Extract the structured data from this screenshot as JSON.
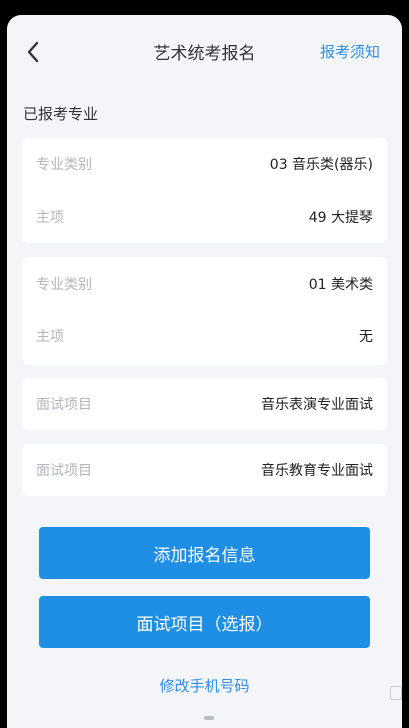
{
  "header": {
    "title": "艺术统考报名",
    "notice_link": "报考须知",
    "back_icon": "chevron-left-icon"
  },
  "section_title": "已报考专业",
  "cards": [
    {
      "rows": [
        {
          "label": "专业类别",
          "value": "03 音乐类(器乐)"
        },
        {
          "label": "主项",
          "value": "49 大提琴"
        }
      ]
    },
    {
      "rows": [
        {
          "label": "专业类别",
          "value": "01 美术类"
        },
        {
          "label": "主项",
          "value": "无"
        }
      ]
    },
    {
      "rows": [
        {
          "label": "面试项目",
          "value": "音乐表演专业面试"
        }
      ]
    },
    {
      "rows": [
        {
          "label": "面试项目",
          "value": "音乐教育专业面试"
        }
      ]
    }
  ],
  "buttons": {
    "add_info": "添加报名信息",
    "interview": "面试项目（选报）"
  },
  "change_phone_link": "修改手机号码",
  "colors": {
    "accent": "#1f8fe6",
    "link": "#2f8fe6",
    "background": "#f3f5f9"
  }
}
